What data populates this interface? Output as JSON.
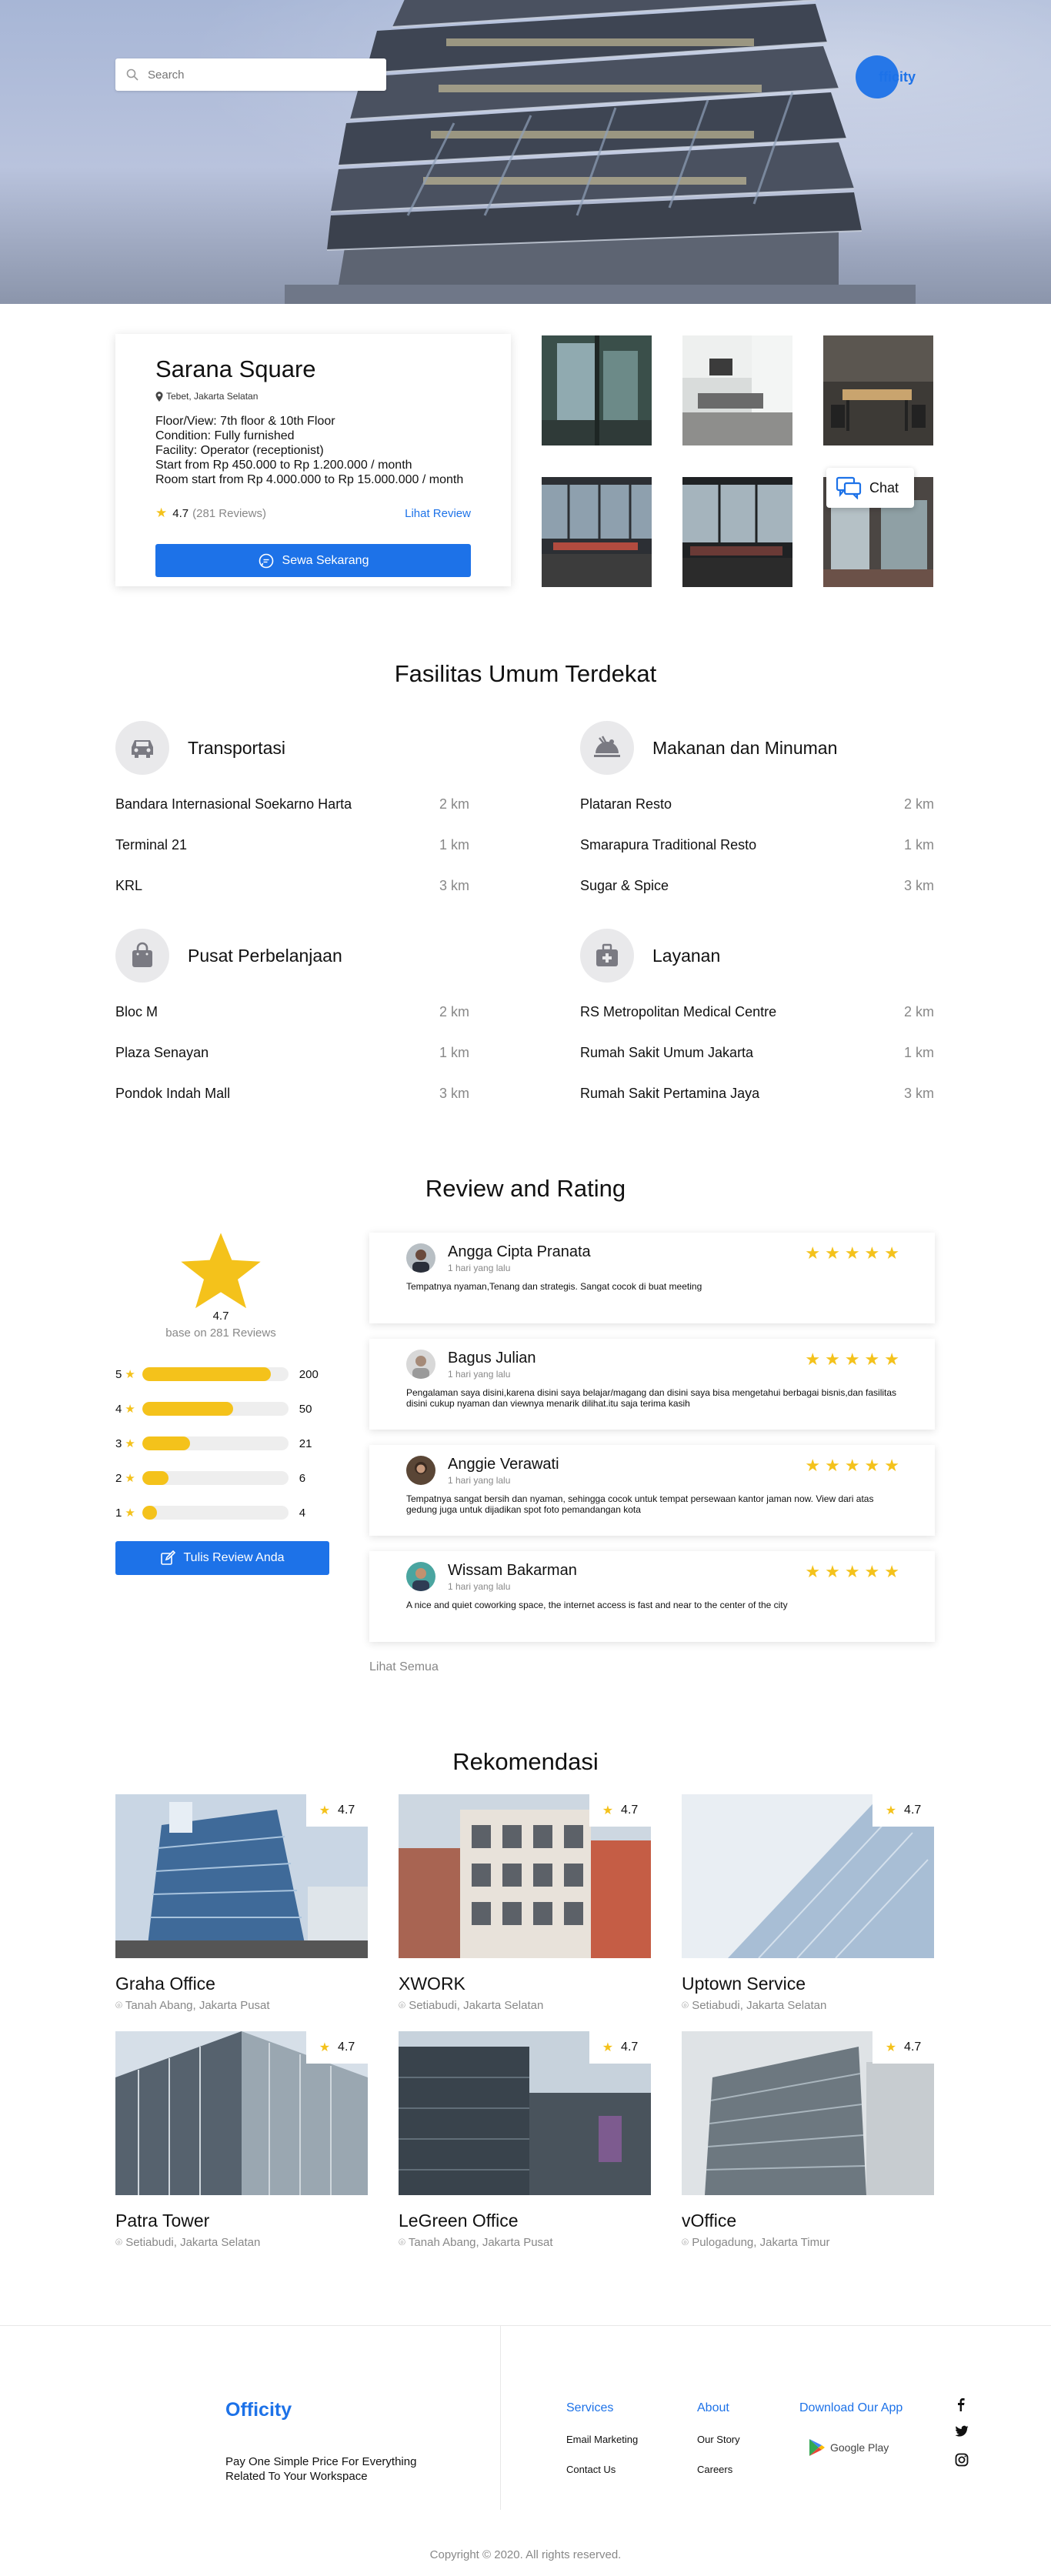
{
  "search": {
    "placeholder": "Search"
  },
  "brand": {
    "name": "Officity",
    "logo_short": "fficity"
  },
  "property": {
    "name": "Sarana Square",
    "location": "Tebet, Jakarta Selatan",
    "details": [
      "Floor/View: 7th floor & 10th Floor",
      "Condition: Fully furnished",
      "Facility: Operator (receptionist)",
      "Start from Rp 450.000 to Rp 1.200.000 / month",
      "Room start from Rp 4.000.000 to Rp 15.000.000 / month"
    ],
    "rating": "4.7",
    "reviews_count": "(281 Reviews)",
    "review_link": "Lihat Review",
    "cta": "Sewa Sekarang",
    "chat": "Chat"
  },
  "facilities": {
    "title": "Fasilitas Umum Terdekat",
    "groups": [
      {
        "title": "Transportasi",
        "icon": "car-icon",
        "items": [
          {
            "name": "Bandara Internasional Soekarno Harta",
            "dist": "2 km"
          },
          {
            "name": "Terminal 21",
            "dist": "1 km"
          },
          {
            "name": "KRL",
            "dist": "3 km"
          }
        ]
      },
      {
        "title": "Makanan dan Minuman",
        "icon": "food-icon",
        "items": [
          {
            "name": "Plataran Resto",
            "dist": "2 km"
          },
          {
            "name": "Smarapura Traditional Resto",
            "dist": "1 km"
          },
          {
            "name": "Sugar & Spice",
            "dist": "3 km"
          }
        ]
      },
      {
        "title": "Pusat Perbelanjaan",
        "icon": "shopping-bag-icon",
        "items": [
          {
            "name": "Bloc M",
            "dist": "2 km"
          },
          {
            "name": "Plaza Senayan",
            "dist": "1 km"
          },
          {
            "name": "Pondok Indah Mall",
            "dist": "3 km"
          }
        ]
      },
      {
        "title": "Layanan",
        "icon": "medical-kit-icon",
        "items": [
          {
            "name": "RS Metropolitan Medical Centre",
            "dist": "2 km"
          },
          {
            "name": "Rumah Sakit Umum Jakarta",
            "dist": "1 km"
          },
          {
            "name": "Rumah Sakit Pertamina Jaya",
            "dist": "3 km"
          }
        ]
      }
    ]
  },
  "reviews": {
    "title": "Review and Rating",
    "average": "4.7",
    "base": "base on 281 Reviews",
    "distribution": [
      {
        "star": "5",
        "count": "200",
        "fraction": 0.88
      },
      {
        "star": "4",
        "count": "50",
        "fraction": 0.62
      },
      {
        "star": "3",
        "count": "21",
        "fraction": 0.33
      },
      {
        "star": "2",
        "count": "6",
        "fraction": 0.18
      },
      {
        "star": "1",
        "count": "4",
        "fraction": 0.1
      }
    ],
    "write_button": "Tulis Review Anda",
    "see_all": "Lihat Semua",
    "items": [
      {
        "name": "Angga Cipta Pranata",
        "time": "1 hari yang lalu",
        "stars": "★★★★★",
        "text": "Tempatnya nyaman,Tenang dan strategis. Sangat cocok di buat meeting"
      },
      {
        "name": "Bagus Julian",
        "time": "1 hari yang lalu",
        "stars": "★★★★★",
        "text": "Pengalaman saya disini,karena disini saya belajar/magang dan disini saya bisa mengetahui berbagai bisnis,dan fasilitas disini cukup nyaman dan viewnya menarik dilihat.itu saja terima kasih"
      },
      {
        "name": "Anggie Verawati",
        "time": "1 hari yang lalu",
        "stars": "★★★★★",
        "text": "Tempatnya sangat bersih dan nyaman, sehingga cocok untuk tempat persewaan kantor jaman now. View dari atas gedung juga untuk dijadikan spot foto pemandangan kota"
      },
      {
        "name": "Wissam Bakarman",
        "time": "1 hari yang lalu",
        "stars": "★★★★★",
        "text": "A nice and quiet coworking space, the internet access is fast and near to the center of the city"
      }
    ]
  },
  "recommendations": {
    "title": "Rekomendasi",
    "items": [
      {
        "name": "Graha Office",
        "address": "Tanah Abang, Jakarta Pusat",
        "rating": "4.7"
      },
      {
        "name": "XWORK",
        "address": "Setiabudi, Jakarta Selatan",
        "rating": "4.7"
      },
      {
        "name": "Uptown Service",
        "address": "Setiabudi, Jakarta Selatan",
        "rating": "4.7"
      },
      {
        "name": "Patra Tower",
        "address": "Setiabudi, Jakarta Selatan",
        "rating": "4.7"
      },
      {
        "name": "LeGreen Office",
        "address": "Tanah Abang, Jakarta Pusat",
        "rating": "4.7"
      },
      {
        "name": "vOffice",
        "address": "Pulogadung, Jakarta Timur",
        "rating": "4.7"
      }
    ]
  },
  "footer": {
    "logo": "Officity",
    "tagline": "Pay One Simple Price For Everything Related To Your Workspace",
    "services": {
      "title": "Services",
      "items": [
        "Email Marketing",
        "Contact Us"
      ]
    },
    "about": {
      "title": "About",
      "items": [
        "Our Story",
        "Careers"
      ]
    },
    "app": {
      "title": "Download Our App",
      "store": "Google Play"
    },
    "copyright": "Copyright © 2020. All rights reserved."
  },
  "colors": {
    "accent": "#1d72e8",
    "star": "#f4c21b"
  }
}
